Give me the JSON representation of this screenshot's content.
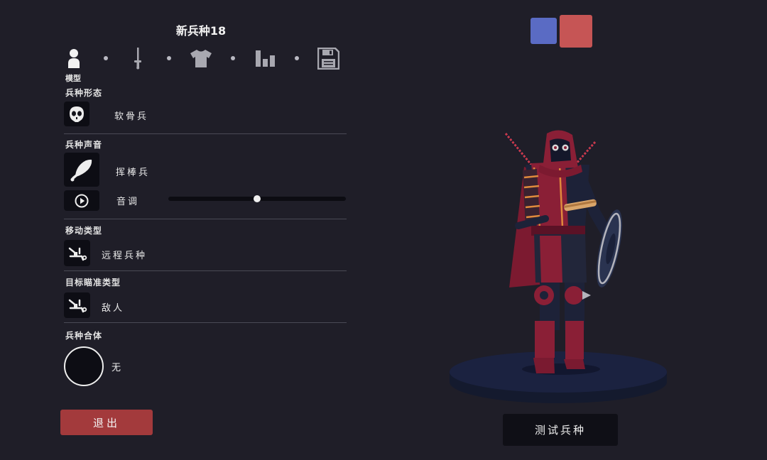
{
  "header": {
    "title": "新兵种18"
  },
  "tabs": [
    {
      "name": "model",
      "icon": "person-icon",
      "label": "模型",
      "selected": true
    },
    {
      "name": "weapon",
      "icon": "sword-icon",
      "label": ""
    },
    {
      "name": "clothing",
      "icon": "shirt-icon",
      "label": ""
    },
    {
      "name": "stats",
      "icon": "bar-chart-icon",
      "label": ""
    },
    {
      "name": "save",
      "icon": "floppy-disk-icon",
      "label": ""
    }
  ],
  "sections": {
    "form": {
      "label": "兵种形态",
      "icon": "skull-mask-icon",
      "value": "软骨兵"
    },
    "voice": {
      "label": "兵种声音",
      "icon": "club-icon",
      "value": "挥棒兵",
      "pitch_label": "音调",
      "pitch_play_icon": "play-circle-icon",
      "pitch_level": 0.5
    },
    "movement": {
      "label": "移动类型",
      "icon": "ranged-unit-icon",
      "value": "远程兵种"
    },
    "targeting": {
      "label": "目标瞄准类型",
      "icon": "target-enemy-icon",
      "value": "敌人"
    },
    "combine": {
      "label": "兵种合体",
      "icon": "empty-circle-icon",
      "value": "无"
    }
  },
  "buttons": {
    "exit": "退出",
    "test": "测试兵种"
  },
  "team_colors": {
    "blue": "#5a6bc4",
    "red": "#c65555",
    "selected": "red"
  },
  "colors": {
    "background": "#1f1e28",
    "exit_button": "#a33a3c",
    "unit_primary": "#8a1f36",
    "unit_dark": "#1d2238",
    "unit_trim": "#e08a3c",
    "pedestal": "#1a2038"
  }
}
